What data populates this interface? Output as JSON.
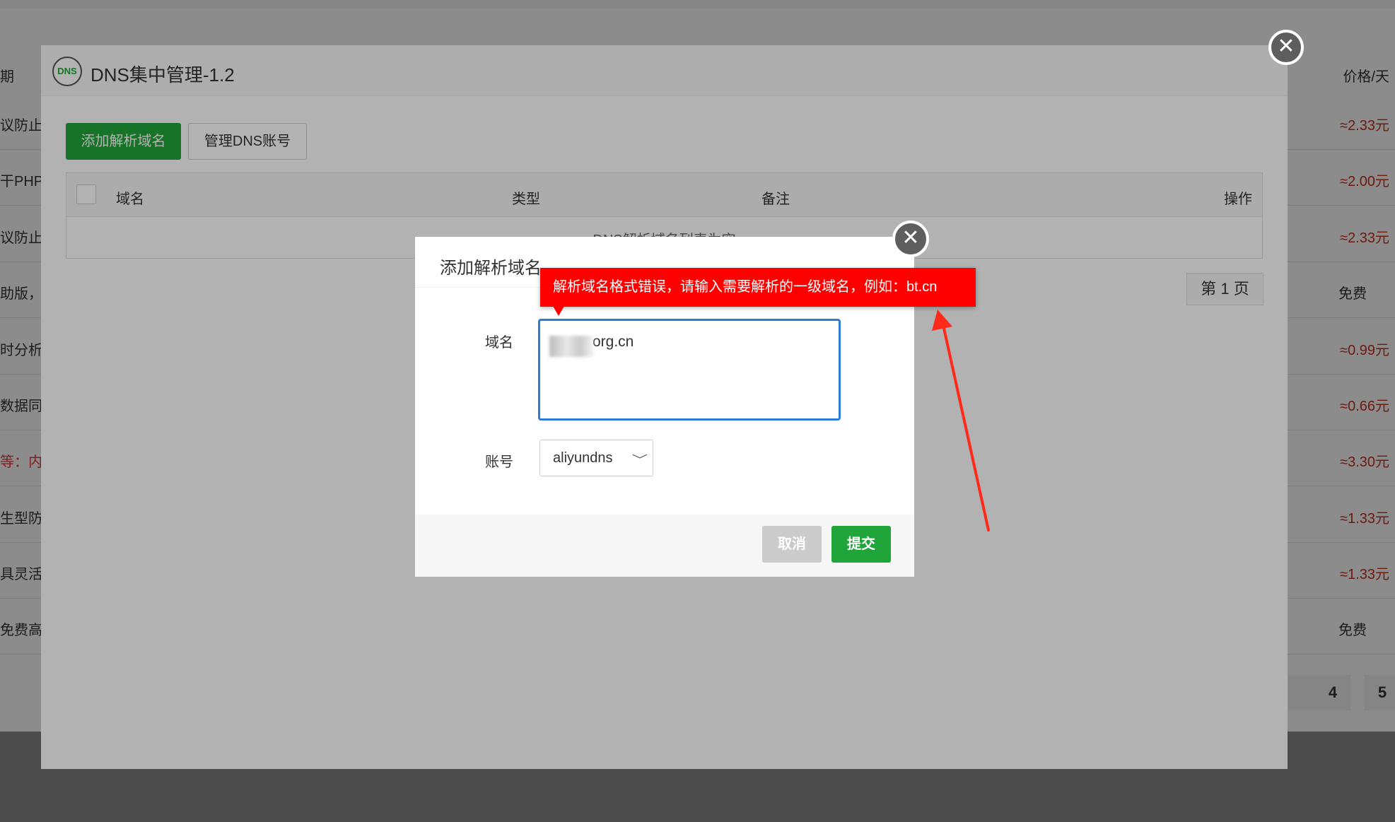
{
  "background": {
    "header_left": "期",
    "header_right": "价格/天",
    "rows": [
      {
        "left": "议防止s",
        "right": "≈2.33元",
        "left_red": false
      },
      {
        "left": "干PHP内",
        "right": "≈2.00元",
        "left_red": false
      },
      {
        "left": "议防止s",
        "right": "≈2.33元",
        "left_red": false
      },
      {
        "left": "助版，基",
        "right": "免费",
        "left_red": false
      },
      {
        "left": "时分析网",
        "right": "≈0.99元",
        "left_red": false
      },
      {
        "left": "数据同步",
        "right": "≈0.66元",
        "left_red": false
      },
      {
        "left": "等：内核",
        "right": "≈3.30元",
        "left_red": true
      },
      {
        "left": "生型防篡",
        "right": "≈1.33元",
        "left_red": false
      },
      {
        "left": "具灵活的",
        "right": "≈1.33元",
        "left_red": false
      },
      {
        "left": "免费高效",
        "right": "免费",
        "left_red": false
      }
    ],
    "pager": [
      "4",
      "5"
    ]
  },
  "panel": {
    "logo": "DNS",
    "title": "DNS集中管理-1.2",
    "close": "✕",
    "add_button": "添加解析域名",
    "manage_button": "管理DNS账号",
    "table": {
      "col_domain": "域名",
      "col_type": "类型",
      "col_note": "备注",
      "col_action": "操作",
      "empty": "DNS解析域名列表为空"
    },
    "page": "第 1 页"
  },
  "dialog": {
    "title": "添加解析域名",
    "close": "✕",
    "domain_label": "域名",
    "domain_value": "org.cn",
    "account_label": "账号",
    "account_value": "aliyundns",
    "chevron": "﹀",
    "cancel": "取消",
    "submit": "提交"
  },
  "tooltip": {
    "text": "解析域名格式错误，请输入需要解析的一级域名，例如：bt.cn"
  },
  "colors": {
    "accent_green": "#20a53a",
    "error_red": "#ff0000",
    "focus_blue": "#2d7bd5",
    "price_red": "#c7311c"
  }
}
